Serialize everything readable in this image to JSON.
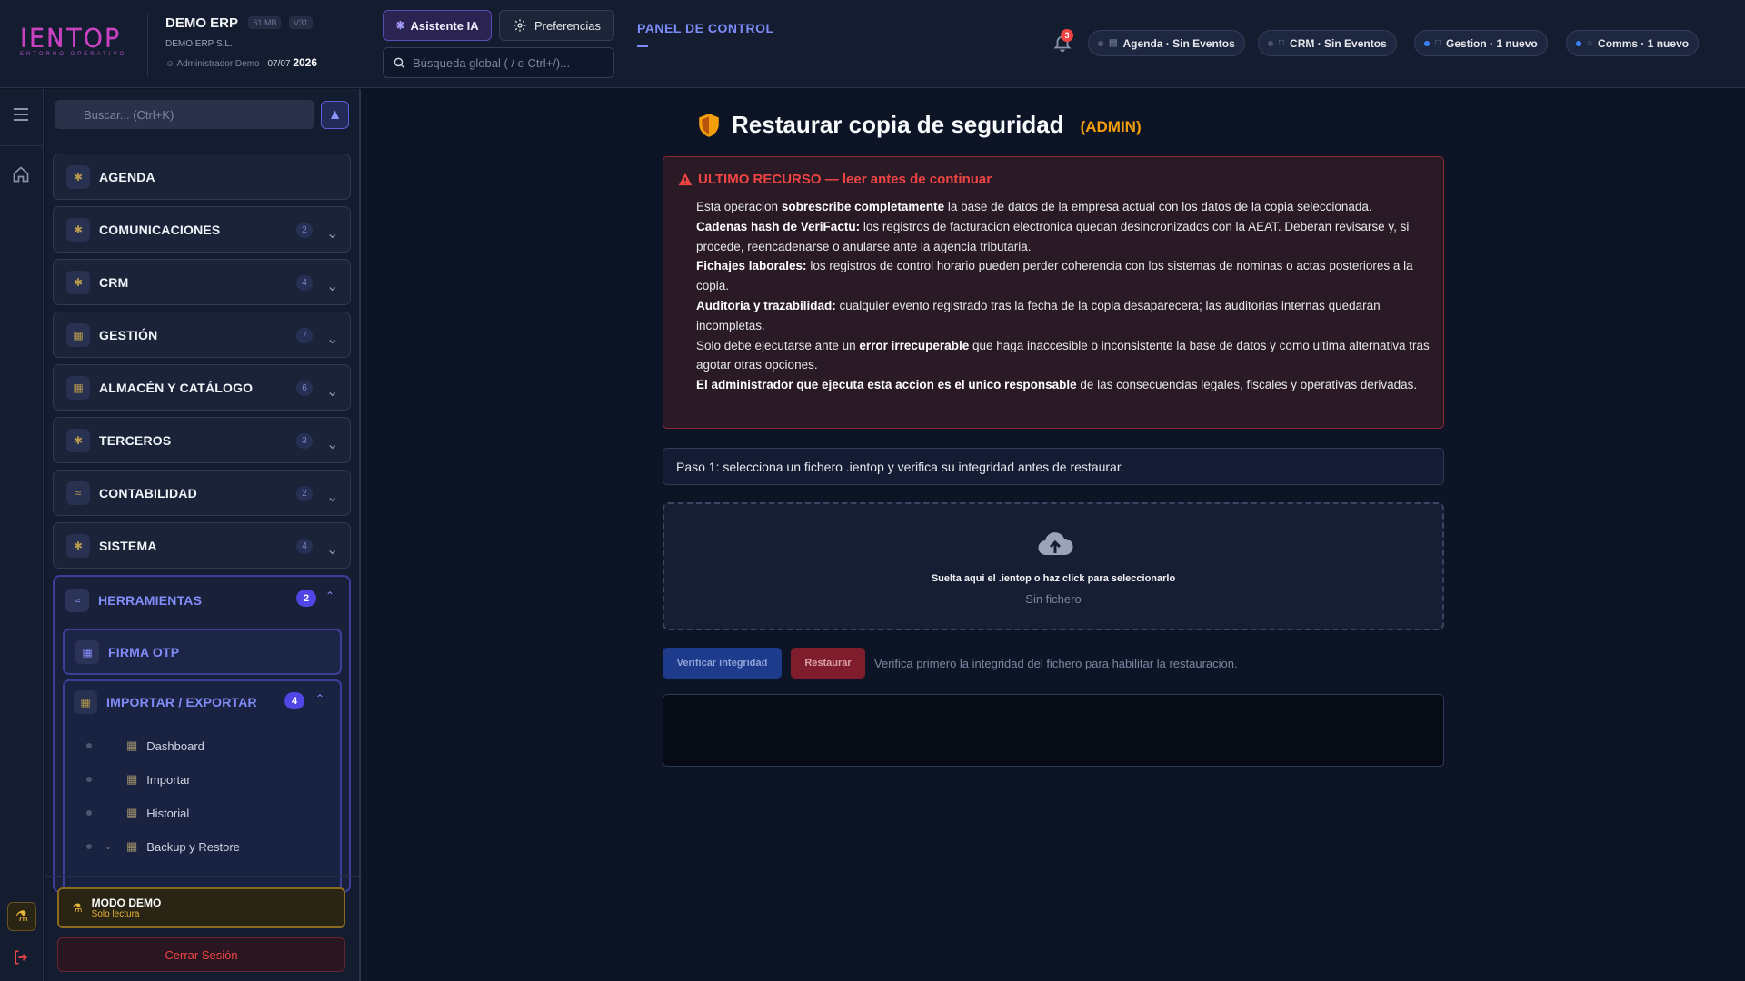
{
  "brand": {
    "logo": "IENTOP",
    "logo_sub": "ENTORNO OPERATIVO"
  },
  "company": {
    "name": "DEMO ERP",
    "size_tag": "61 MB",
    "version_tag": "V31",
    "legal_name": "DEMO ERP S.L.",
    "user": "Administrador Demo",
    "date": "07/07",
    "year": "2026"
  },
  "toolbar": {
    "ai_label": "Asistente IA",
    "prefs_label": "Preferencias",
    "search_placeholder": "Búsqueda global ( / o Ctrl+/)...",
    "panel_label": "PANEL DE CONTROL"
  },
  "notifications": {
    "count": "3"
  },
  "pills": [
    {
      "label": "Agenda · Sin Eventos"
    },
    {
      "label": "CRM · Sin Eventos"
    },
    {
      "label": "Gestion · 1 nuevo"
    },
    {
      "label": "Comms · 1 nuevo"
    }
  ],
  "sidebar": {
    "search_placeholder": "Buscar... (Ctrl+K)",
    "items": [
      {
        "label": "AGENDA",
        "count": ""
      },
      {
        "label": "COMUNICACIONES",
        "count": "2"
      },
      {
        "label": "CRM",
        "count": "4"
      },
      {
        "label": "GESTIÓN",
        "count": "7"
      },
      {
        "label": "ALMACÉN Y CATÁLOGO",
        "count": "6"
      },
      {
        "label": "TERCEROS",
        "count": "3"
      },
      {
        "label": "CONTABILIDAD",
        "count": "2"
      },
      {
        "label": "SISTEMA",
        "count": "4"
      }
    ],
    "tools": {
      "label": "HERRAMIENTAS",
      "count": "2",
      "firma": "FIRMA OTP",
      "import_export": {
        "label": "IMPORTAR / EXPORTAR",
        "count": "4"
      },
      "leaves": [
        "Dashboard",
        "Importar",
        "Historial",
        "Backup y Restore"
      ]
    },
    "demo": {
      "title": "MODO DEMO",
      "subtitle": "Solo lectura"
    },
    "logout_label": "Cerrar Sesión"
  },
  "main": {
    "title": "Restaurar copia de seguridad",
    "title_tag": "(ADMIN)",
    "warning": {
      "heading": "ULTIMO RECURSO — leer antes de continuar",
      "p1_a": "Esta operacion ",
      "p1_b": "sobrescribe completamente",
      "p1_c": " la base de datos de la empresa actual con los datos de la copia seleccionada.",
      "p2_b": "Cadenas hash de VeriFactu:",
      "p2_c": " los registros de facturacion electronica quedan desincronizados con la AEAT. Deberan revisarse y, si procede, reencadenarse o anularse ante la agencia tributaria.",
      "p3_b": "Fichajes laborales:",
      "p3_c": " los registros de control horario pueden perder coherencia con los sistemas de nominas o actas posteriores a la copia.",
      "p4_b": "Auditoria y trazabilidad:",
      "p4_c": " cualquier evento registrado tras la fecha de la copia desaparecera; las auditorias internas quedaran incompletas.",
      "p5_a": "Solo debe ejecutarse ante un ",
      "p5_b": "error irrecuperable",
      "p5_c": " que haga inaccesible o inconsistente la base de datos y como ultima alternativa tras agotar otras opciones.",
      "p6_b": "El administrador que ejecuta esta accion es el unico responsable",
      "p6_c": " de las consecuencias legales, fiscales y operativas derivadas."
    },
    "step": "Paso 1: selecciona un fichero .ientop y verifica su integridad antes de restaurar.",
    "drop": {
      "text": "Suelta aqui el .ientop o haz click para seleccionarlo",
      "status": "Sin fichero"
    },
    "verify_label": "Verificar integridad",
    "restore_label": "Restaurar",
    "hint": "Verifica primero la integridad del fichero para habilitar la restauracion."
  },
  "colors": {
    "accent": "#818cf8",
    "warning": "#ef4444",
    "admin": "#f59e0b",
    "bg": "#0d1426"
  },
  "icons": [
    "logo",
    "sparkle-icon",
    "gear-icon",
    "search-icon",
    "bell-icon",
    "calendar-icon",
    "crm-icon",
    "doc-icon",
    "chat-icon",
    "menu-icon",
    "home-icon",
    "beaker-icon",
    "logout-icon",
    "pin-icon",
    "chevron-down-icon",
    "chevron-up-icon",
    "shield-icon",
    "alert-triangle-icon",
    "cloud-upload-icon"
  ]
}
